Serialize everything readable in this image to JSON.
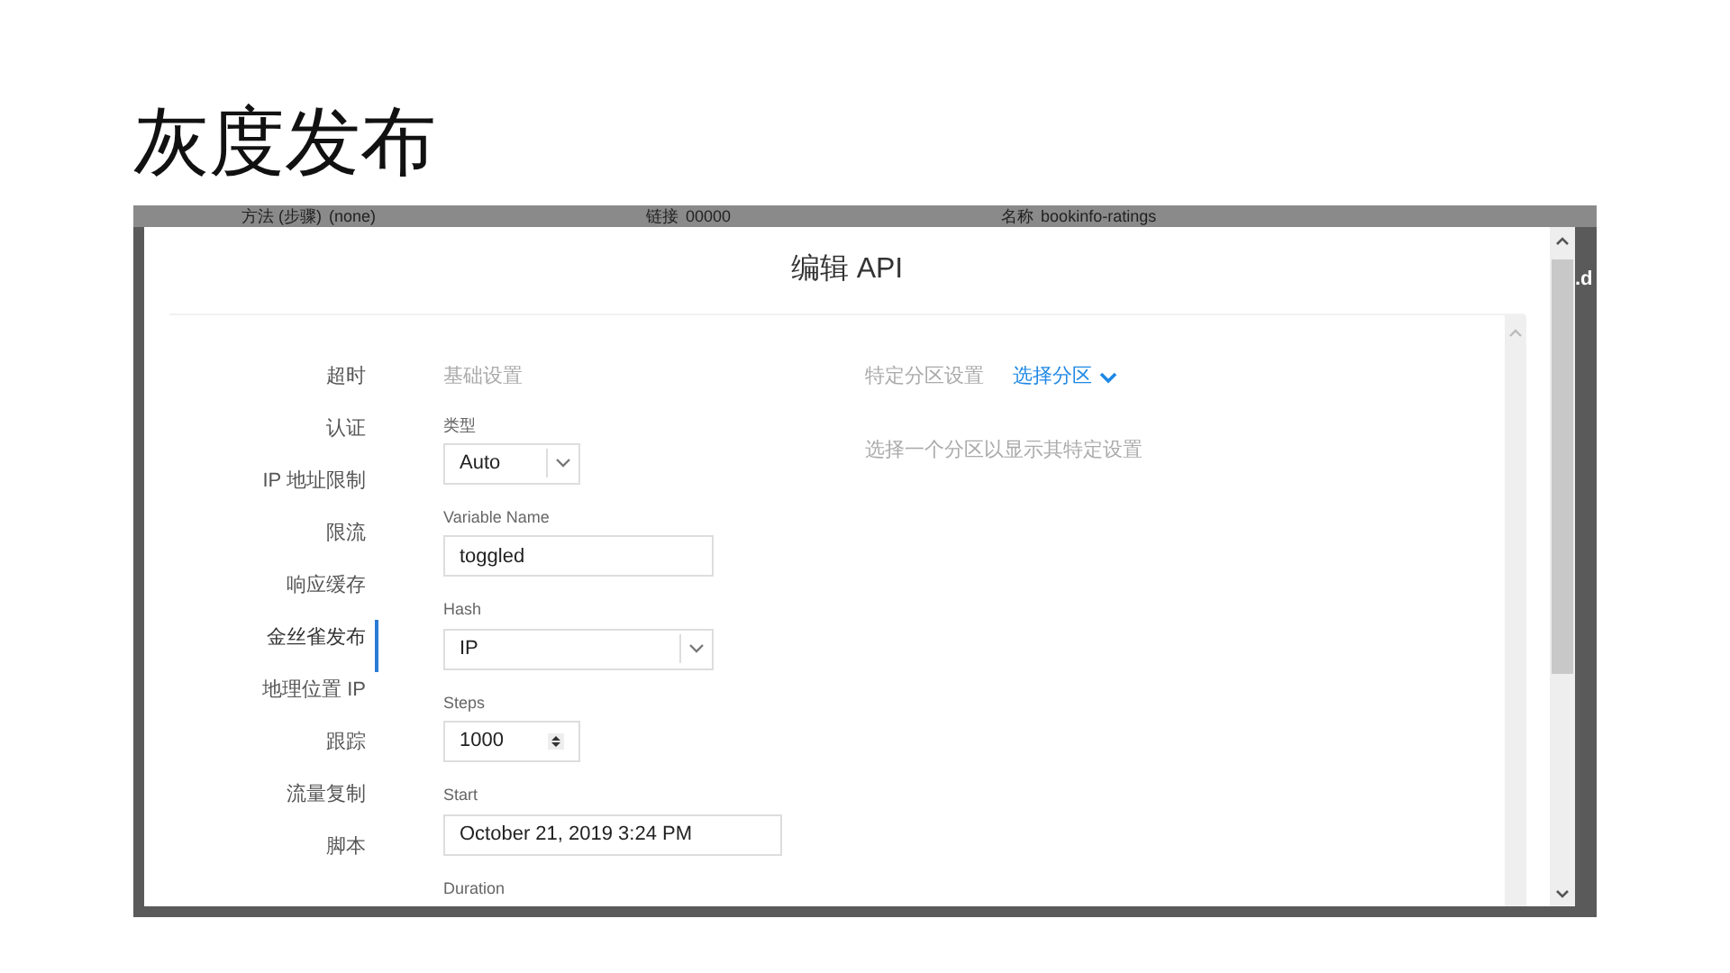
{
  "slide_title": "灰度发布",
  "background_texts": [
    {
      "label": "方法 (步骤)",
      "value": "(none)"
    },
    {
      "label": "链接",
      "value": "00000"
    },
    {
      "label": "名称",
      "value": "bookinfo-ratings"
    }
  ],
  "background_edge_text": ".d",
  "modal": {
    "title": "编辑 API",
    "nav_items": [
      {
        "label": "超时",
        "selected": false
      },
      {
        "label": "认证",
        "selected": false
      },
      {
        "label": "IP 地址限制",
        "selected": false
      },
      {
        "label": "限流",
        "selected": false
      },
      {
        "label": "响应缓存",
        "selected": false
      },
      {
        "label": "金丝雀发布",
        "selected": true
      },
      {
        "label": "地理位置 IP",
        "selected": false
      },
      {
        "label": "跟踪",
        "selected": false
      },
      {
        "label": "流量复制",
        "selected": false
      },
      {
        "label": "脚本",
        "selected": false
      }
    ],
    "basic_heading": "基础设置",
    "fields": [
      {
        "kind": "select",
        "label": "类型",
        "value": "Auto"
      },
      {
        "kind": "text",
        "label": "Variable Name",
        "value": "toggled"
      },
      {
        "kind": "select",
        "label": "Hash",
        "value": "IP"
      },
      {
        "kind": "number",
        "label": "Steps",
        "value": "1000"
      },
      {
        "kind": "text",
        "label": "Start",
        "value": "October 21, 2019 3:24 PM"
      },
      {
        "kind": "label",
        "label": "Duration"
      }
    ],
    "partition_heading": "特定分区设置",
    "partition_select": "选择分区",
    "partition_hint": "选择一个分区以显示其特定设置"
  }
}
